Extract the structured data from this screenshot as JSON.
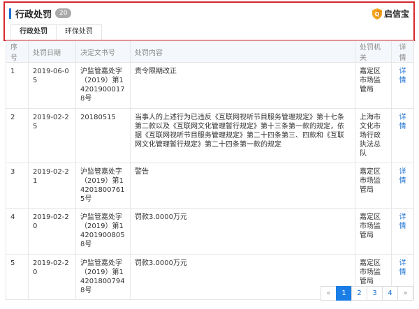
{
  "header": {
    "title": "行政处罚",
    "count": "20",
    "brand": "启信宝",
    "brand_icon": "shield-icon",
    "accent": "#1a6fd0",
    "highlight_border": "#d9252b"
  },
  "tabs": [
    {
      "label": "行政处罚",
      "active": true
    },
    {
      "label": "环保处罚",
      "active": false
    }
  ],
  "table": {
    "columns": [
      "序号",
      "处罚日期",
      "决定文书号",
      "处罚内容",
      "处罚机关",
      "详情"
    ],
    "rows": [
      {
        "no": "1",
        "date": "2019-06-05",
        "doc": "沪监管嘉处字（2019）第142019000178号",
        "content": "责令限期改正",
        "authority": "嘉定区市场监管局",
        "detail": "详情"
      },
      {
        "no": "2",
        "date": "2019-02-25",
        "doc": "20180515",
        "content": "当事人的上述行为已违反《互联网视听节目服务管理规定》第十七条第二款以及《互联网文化管理暂行规定》第十三条第一款的规定，依据《互联网视听节目服务管理规定》第二十四条第三、四款和《互联网文化管理暂行规定》第二十四条第一款的规定",
        "authority": "上海市文化市场行政执法总队",
        "detail": "详情"
      },
      {
        "no": "3",
        "date": "2019-02-21",
        "doc": "沪监管嘉处字（2019）第142018007615号",
        "content": "警告",
        "authority": "嘉定区市场监管局",
        "detail": "详情"
      },
      {
        "no": "4",
        "date": "2019-02-20",
        "doc": "沪监管嘉处字（2019）第142019008058号",
        "content": "罚款3.0000万元",
        "authority": "嘉定区市场监管局",
        "detail": "详情"
      },
      {
        "no": "5",
        "date": "2019-02-20",
        "doc": "沪监管嘉处字（2019）第142018007948号",
        "content": "罚款3.0000万元",
        "authority": "嘉定区市场监管局",
        "detail": "详情"
      }
    ]
  },
  "pagination": {
    "prev": "«",
    "pages": [
      "1",
      "2",
      "3",
      "4"
    ],
    "current": "1",
    "next": "»"
  }
}
